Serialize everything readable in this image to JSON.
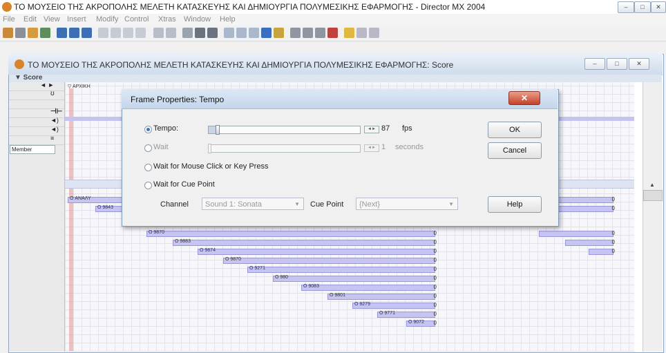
{
  "app": {
    "window_title": "ΤΟ ΜΟΥΣΕΙΟ ΤΗΣ ΑΚΡΟΠΟΛΗΣ ΜΕΛΕΤΗ ΚΑΤΑΣΚΕΥΗΣ ΚΑΙ ΔΗΜΙΟΥΡΓΙΑ ΠΟΛΥΜΕΣΙΚΗΣ ΕΦΑΡΜΟΓΗΣ - Director MX 2004",
    "window_controls": [
      "–",
      "□",
      "✕"
    ]
  },
  "menu": [
    "File",
    "Edit",
    "View",
    "Insert",
    "Modify",
    "Control",
    "Xtras",
    "Window",
    "Help"
  ],
  "score_window": {
    "title": "ΤΟ ΜΟΥΣΕΙΟ ΤΗΣ ΑΚΡΟΠΟΛΗΣ ΜΕΛΕΤΗ ΚΑΤΑΣΚΕΥΗΣ ΚΑΙ ΔΗΜΙΟΥΡΓΙΑ ΠΟΛΥΜΕΣΙΚΗΣ ΕΦΑΡΜΟΓΗΣ: Score",
    "panel_label": "▼ Score",
    "marker_label": "▽ ΑΡΧΙΚΗ",
    "view_select": "Member"
  },
  "sprites": [
    {
      "label": "O ΑΝΑΛΥ"
    },
    {
      "label": "O 9843"
    },
    {
      "label": "O 9870"
    },
    {
      "label": "O 9883"
    },
    {
      "label": "O 9874"
    },
    {
      "label": "O 9870"
    },
    {
      "label": "O 9271"
    },
    {
      "label": "O 980"
    },
    {
      "label": "O 9083"
    },
    {
      "label": "O 9801"
    },
    {
      "label": "O 9279"
    },
    {
      "label": "O 9771"
    },
    {
      "label": "O 9072"
    }
  ],
  "dialog": {
    "title": "Frame Properties: Tempo",
    "close": "✕",
    "tempo_label": "Tempo:",
    "tempo_value": "87",
    "tempo_unit": "fps",
    "wait_label": "Wait",
    "wait_value": "1",
    "wait_unit": "seconds",
    "mouse_label": "Wait for Mouse Click or Key Press",
    "cue_label": "Wait for Cue Point",
    "channel_label": "Channel",
    "channel_value": "Sound 1: Sonata",
    "cue_point_label": "Cue Point",
    "cue_point_value": "{Next}",
    "ok": "OK",
    "cancel": "Cancel",
    "help": "Help",
    "tempo_slider_fraction": 0.04
  }
}
